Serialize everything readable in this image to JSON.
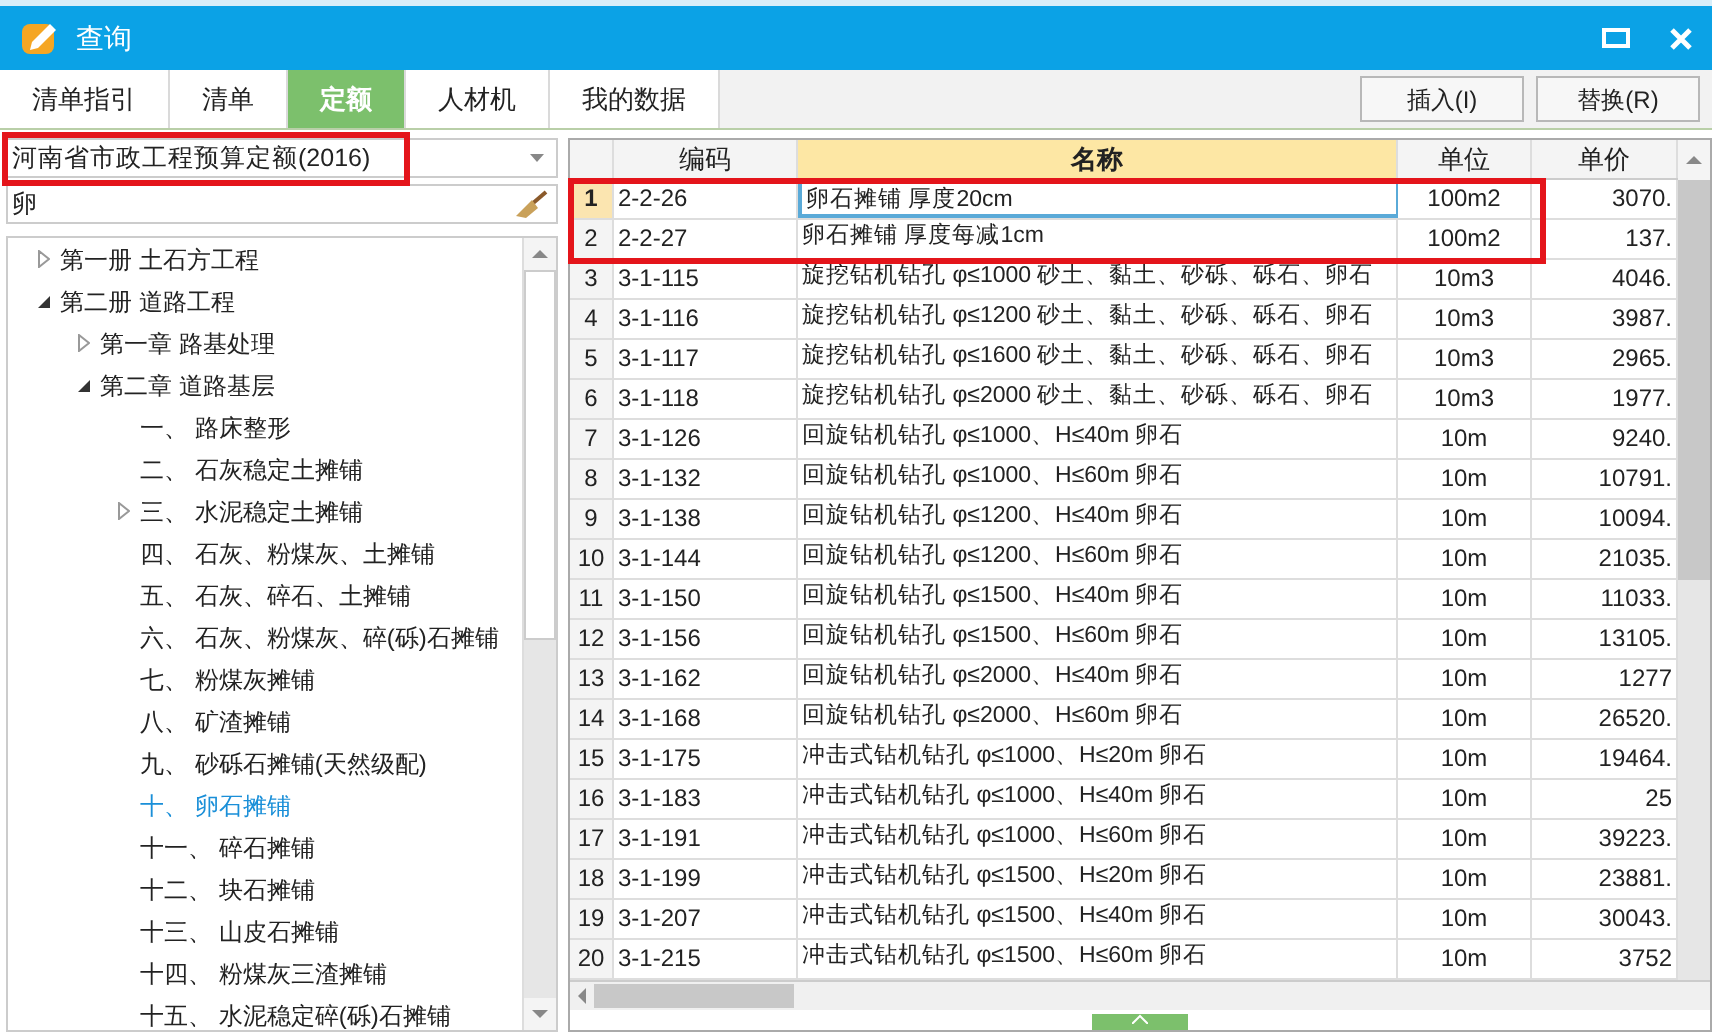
{
  "window": {
    "title": "查询"
  },
  "tabs": [
    {
      "label": "清单指引",
      "selected": false
    },
    {
      "label": "清单",
      "selected": false
    },
    {
      "label": "定额",
      "selected": true
    },
    {
      "label": "人材机",
      "selected": false
    },
    {
      "label": "我的数据",
      "selected": false
    }
  ],
  "buttons": [
    "插入(I)",
    "替换(R)"
  ],
  "library_select": {
    "value": "河南省市政工程预算定额(2016)"
  },
  "search": {
    "value": "卵"
  },
  "tree": [
    {
      "label": "第一册 土石方工程",
      "expanded": false,
      "selected": false
    },
    {
      "label": "第二册 道路工程",
      "expanded": true,
      "selected": false,
      "children": [
        {
          "label": "第一章 路基处理",
          "expanded": false,
          "selected": false
        },
        {
          "label": "第二章 道路基层",
          "expanded": true,
          "selected": false,
          "children": [
            {
              "label": "一、 路床整形",
              "selected": false
            },
            {
              "label": "二、 石灰稳定土摊铺",
              "selected": false
            },
            {
              "label": "三、 水泥稳定土摊铺",
              "expanded": false,
              "selected": false
            },
            {
              "label": "四、 石灰、粉煤灰、土摊铺",
              "selected": false
            },
            {
              "label": "五、 石灰、碎石、土摊铺",
              "selected": false
            },
            {
              "label": "六、 石灰、粉煤灰、碎(砾)石摊铺",
              "selected": false
            },
            {
              "label": "七、 粉煤灰摊铺",
              "selected": false
            },
            {
              "label": "八、 矿渣摊铺",
              "selected": false
            },
            {
              "label": "九、 砂砾石摊铺(天然级配)",
              "selected": false
            },
            {
              "label": "十、 卵石摊铺",
              "selected": true
            },
            {
              "label": "十一、 碎石摊铺",
              "selected": false
            },
            {
              "label": "十二、 块石摊铺",
              "selected": false
            },
            {
              "label": "十三、 山皮石摊铺",
              "selected": false
            },
            {
              "label": "十四、 粉煤灰三渣摊铺",
              "selected": false
            },
            {
              "label": "十五、 水泥稳定碎(砾)石摊铺",
              "selected": false
            }
          ]
        }
      ]
    }
  ],
  "table": {
    "columns": [
      {
        "label": "编码",
        "highlighted": false
      },
      {
        "label": "名称",
        "highlighted": true
      },
      {
        "label": "单位",
        "highlighted": false
      },
      {
        "label": "单价",
        "highlighted": false
      }
    ],
    "rows": [
      {
        "no": "1",
        "code": "2-2-26",
        "name": "卵石摊铺 厚度20cm",
        "unit": "100m2",
        "price": "3070.",
        "selected": true
      },
      {
        "no": "2",
        "code": "2-2-27",
        "name": "卵石摊铺 厚度每减1cm",
        "unit": "100m2",
        "price": "137.",
        "selected": false
      },
      {
        "no": "3",
        "code": "3-1-115",
        "name": "旋挖钻机钻孔 φ≤1000 砂土、黏土、砂砾、砾石、卵石",
        "unit": "10m3",
        "price": "4046.",
        "selected": false
      },
      {
        "no": "4",
        "code": "3-1-116",
        "name": "旋挖钻机钻孔 φ≤1200 砂土、黏土、砂砾、砾石、卵石",
        "unit": "10m3",
        "price": "3987.",
        "selected": false
      },
      {
        "no": "5",
        "code": "3-1-117",
        "name": "旋挖钻机钻孔 φ≤1600 砂土、黏土、砂砾、砾石、卵石",
        "unit": "10m3",
        "price": "2965.",
        "selected": false
      },
      {
        "no": "6",
        "code": "3-1-118",
        "name": "旋挖钻机钻孔 φ≤2000 砂土、黏土、砂砾、砾石、卵石",
        "unit": "10m3",
        "price": "1977.",
        "selected": false
      },
      {
        "no": "7",
        "code": "3-1-126",
        "name": "回旋钻机钻孔 φ≤1000、H≤40m 卵石",
        "unit": "10m",
        "price": "9240.",
        "selected": false
      },
      {
        "no": "8",
        "code": "3-1-132",
        "name": "回旋钻机钻孔 φ≤1000、H≤60m 卵石",
        "unit": "10m",
        "price": "10791.",
        "selected": false
      },
      {
        "no": "9",
        "code": "3-1-138",
        "name": "回旋钻机钻孔 φ≤1200、H≤40m 卵石",
        "unit": "10m",
        "price": "10094.",
        "selected": false
      },
      {
        "no": "10",
        "code": "3-1-144",
        "name": "回旋钻机钻孔 φ≤1200、H≤60m 卵石",
        "unit": "10m",
        "price": "21035.",
        "selected": false
      },
      {
        "no": "11",
        "code": "3-1-150",
        "name": "回旋钻机钻孔 φ≤1500、H≤40m 卵石",
        "unit": "10m",
        "price": "11033.",
        "selected": false
      },
      {
        "no": "12",
        "code": "3-1-156",
        "name": "回旋钻机钻孔 φ≤1500、H≤60m 卵石",
        "unit": "10m",
        "price": "13105.",
        "selected": false
      },
      {
        "no": "13",
        "code": "3-1-162",
        "name": "回旋钻机钻孔 φ≤2000、H≤40m 卵石",
        "unit": "10m",
        "price": "1277",
        "selected": false
      },
      {
        "no": "14",
        "code": "3-1-168",
        "name": "回旋钻机钻孔 φ≤2000、H≤60m 卵石",
        "unit": "10m",
        "price": "26520.",
        "selected": false
      },
      {
        "no": "15",
        "code": "3-1-175",
        "name": "冲击式钻机钻孔 φ≤1000、H≤20m 卵石",
        "unit": "10m",
        "price": "19464.",
        "selected": false
      },
      {
        "no": "16",
        "code": "3-1-183",
        "name": "冲击式钻机钻孔 φ≤1000、H≤40m 卵石",
        "unit": "10m",
        "price": "25",
        "selected": false
      },
      {
        "no": "17",
        "code": "3-1-191",
        "name": "冲击式钻机钻孔 φ≤1000、H≤60m 卵石",
        "unit": "10m",
        "price": "39223.",
        "selected": false
      },
      {
        "no": "18",
        "code": "3-1-199",
        "name": "冲击式钻机钻孔 φ≤1500、H≤20m 卵石",
        "unit": "10m",
        "price": "23881.",
        "selected": false
      },
      {
        "no": "19",
        "code": "3-1-207",
        "name": "冲击式钻机钻孔 φ≤1500、H≤40m 卵石",
        "unit": "10m",
        "price": "30043.",
        "selected": false
      },
      {
        "no": "20",
        "code": "3-1-215",
        "name": "冲击式钻机钻孔 φ≤1500、H≤60m 卵石",
        "unit": "10m",
        "price": "3752",
        "selected": false
      }
    ]
  }
}
